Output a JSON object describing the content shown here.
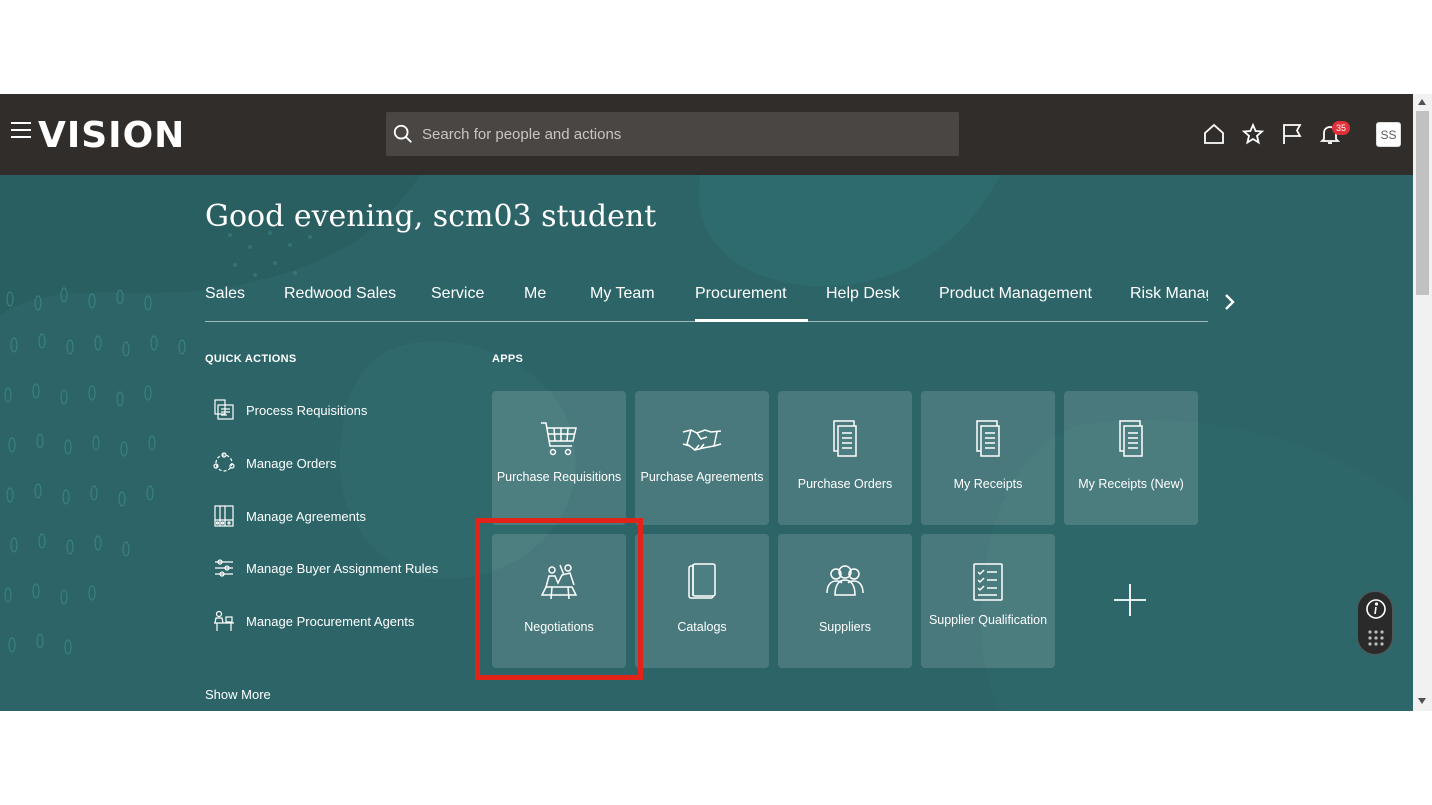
{
  "app": {
    "logo_text": "VISION"
  },
  "search": {
    "placeholder": "Search for people and actions"
  },
  "notifications": {
    "count": "35"
  },
  "user": {
    "initials": "SS"
  },
  "greeting": "Good evening, scm03 student",
  "tabs": [
    {
      "label": "Sales"
    },
    {
      "label": "Redwood Sales"
    },
    {
      "label": "Service"
    },
    {
      "label": "Me"
    },
    {
      "label": "My Team"
    },
    {
      "label": "Procurement",
      "active": true
    },
    {
      "label": "Help Desk"
    },
    {
      "label": "Product Management"
    },
    {
      "label": "Risk Management"
    }
  ],
  "quick_actions": {
    "title": "QUICK ACTIONS",
    "items": [
      {
        "label": "Process Requisitions",
        "icon": "requisitions-icon"
      },
      {
        "label": "Manage Orders",
        "icon": "orders-cycle-icon"
      },
      {
        "label": "Manage Agreements",
        "icon": "agreements-binder-icon"
      },
      {
        "label": "Manage Buyer Assignment Rules",
        "icon": "rules-sliders-icon"
      },
      {
        "label": "Manage Procurement Agents",
        "icon": "agent-desk-icon"
      }
    ],
    "show_more": "Show More"
  },
  "apps": {
    "title": "APPS",
    "tiles": [
      {
        "label": "Purchase Requisitions",
        "icon": "shopping-cart-icon"
      },
      {
        "label": "Purchase Agreements",
        "icon": "handshake-icon"
      },
      {
        "label": "Purchase Orders",
        "icon": "document-stack-icon"
      },
      {
        "label": "My Receipts",
        "icon": "document-stack-icon"
      },
      {
        "label": "My Receipts (New)",
        "icon": "document-stack-icon"
      },
      {
        "label": "Negotiations",
        "icon": "negotiation-icon"
      },
      {
        "label": "Catalogs",
        "icon": "catalog-book-icon"
      },
      {
        "label": "Suppliers",
        "icon": "people-group-icon"
      },
      {
        "label": "Supplier Qualification",
        "icon": "checklist-icon"
      }
    ]
  },
  "colors": {
    "topbar": "#312d2a",
    "content_bg": "#2c6467",
    "highlight": "#e2231a",
    "badge": "#e0303a"
  }
}
